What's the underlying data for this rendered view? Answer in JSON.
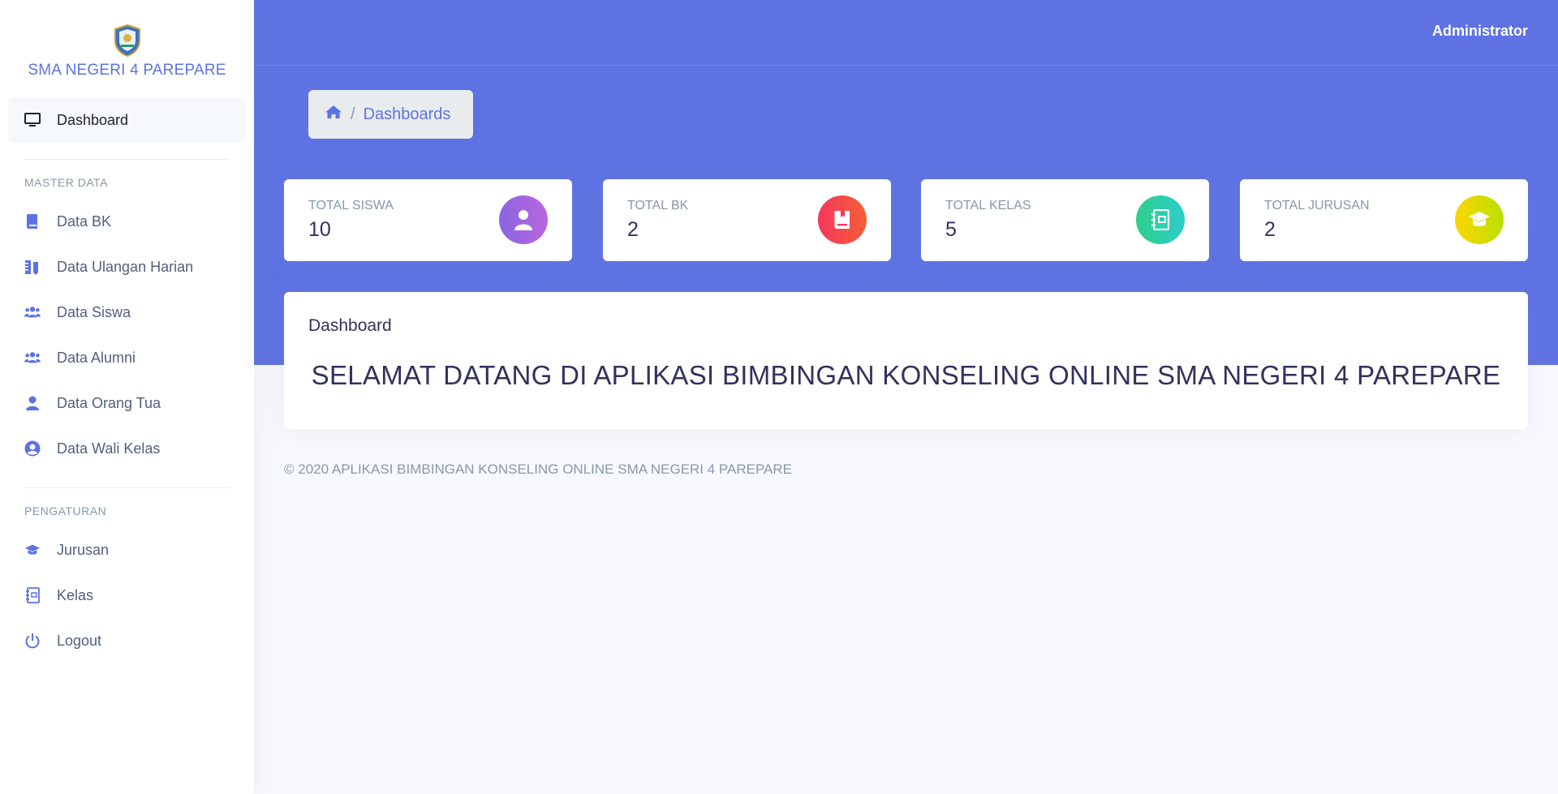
{
  "brand": {
    "name": "SMA NEGERI 4 PAREPARE",
    "logo": "school-crest-logo"
  },
  "sidebar": {
    "dashboard": {
      "label": "Dashboard",
      "icon": "monitor-icon"
    },
    "master_heading": "MASTER DATA",
    "master_items": [
      {
        "label": "Data BK",
        "icon": "book-icon"
      },
      {
        "label": "Data Ulangan Harian",
        "icon": "ruler-pencil-icon"
      },
      {
        "label": "Data Siswa",
        "icon": "users-icon"
      },
      {
        "label": "Data Alumni",
        "icon": "users-icon"
      },
      {
        "label": "Data Orang Tua",
        "icon": "user-icon"
      },
      {
        "label": "Data Wali Kelas",
        "icon": "user-circle-icon"
      }
    ],
    "settings_heading": "PENGATURAN",
    "settings_items": [
      {
        "label": "Jurusan",
        "icon": "graduation-cap-icon"
      },
      {
        "label": "Kelas",
        "icon": "notebook-icon"
      },
      {
        "label": "Logout",
        "icon": "power-icon"
      }
    ]
  },
  "topbar": {
    "user": "Administrator"
  },
  "breadcrumb": {
    "home_icon": "home-icon",
    "current": "Dashboards",
    "separator": "/"
  },
  "stats": [
    {
      "title": "TOTAL SISWA",
      "value": "10",
      "color": "#825ee4",
      "icon": "user-icon"
    },
    {
      "title": "TOTAL BK",
      "value": "2",
      "color": "#f5365c",
      "icon": "book-icon"
    },
    {
      "title": "TOTAL KELAS",
      "value": "5",
      "color": "#2dce89",
      "icon": "notebook-icon"
    },
    {
      "title": "TOTAL JURUSAN",
      "value": "2",
      "color": "#ffd600",
      "icon": "graduation-cap-icon"
    }
  ],
  "welcome": {
    "heading": "Dashboard",
    "message": "SELAMAT DATANG DI APLIKASI BIMBINGAN KONSELING ONLINE SMA NEGERI 4 PAREPARE"
  },
  "footer": "© 2020 APLIKASI BIMBINGAN KONSELING ONLINE SMA NEGERI 4 PAREPARE",
  "colors": {
    "primary": "#5e72e4",
    "background": "#f8f9fe"
  }
}
